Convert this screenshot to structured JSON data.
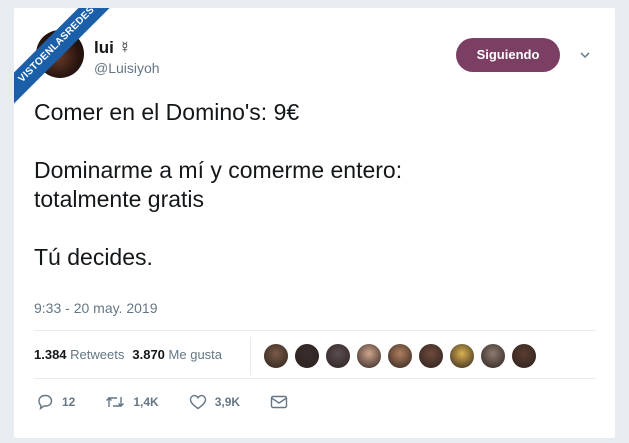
{
  "watermark": "VISTOENLASREDES",
  "user": {
    "name": "lui ☿",
    "handle": "@Luisiyoh",
    "follow_label": "Siguiendo"
  },
  "tweet": {
    "line1": "Comer en el Domino's: 9€",
    "line2": "Dominarme a mí y comerme entero:",
    "line3": "totalmente gratis",
    "line4": "Tú decides.",
    "timestamp": "9:33 - 20 may. 2019"
  },
  "stats": {
    "retweets_count": "1.384",
    "retweets_label": "Retweets",
    "likes_count": "3.870",
    "likes_label": "Me gusta"
  },
  "likers_faces": [
    "#7a5a46",
    "#3a2e2c",
    "#5b4d52",
    "#cfa58f",
    "#b0805e",
    "#6e4a3b",
    "#d9b04f",
    "#8c7a6e",
    "#5a3d30"
  ],
  "actions": {
    "replies": "12",
    "retweets": "1,4K",
    "likes": "3,9K"
  },
  "colors": {
    "follow_button": "#7b3f63",
    "ribbon": "#1a5fa8",
    "secondary_text": "#657786"
  },
  "icons": [
    "chevron-down-icon",
    "reply-icon",
    "retweet-icon",
    "like-icon",
    "message-icon"
  ]
}
